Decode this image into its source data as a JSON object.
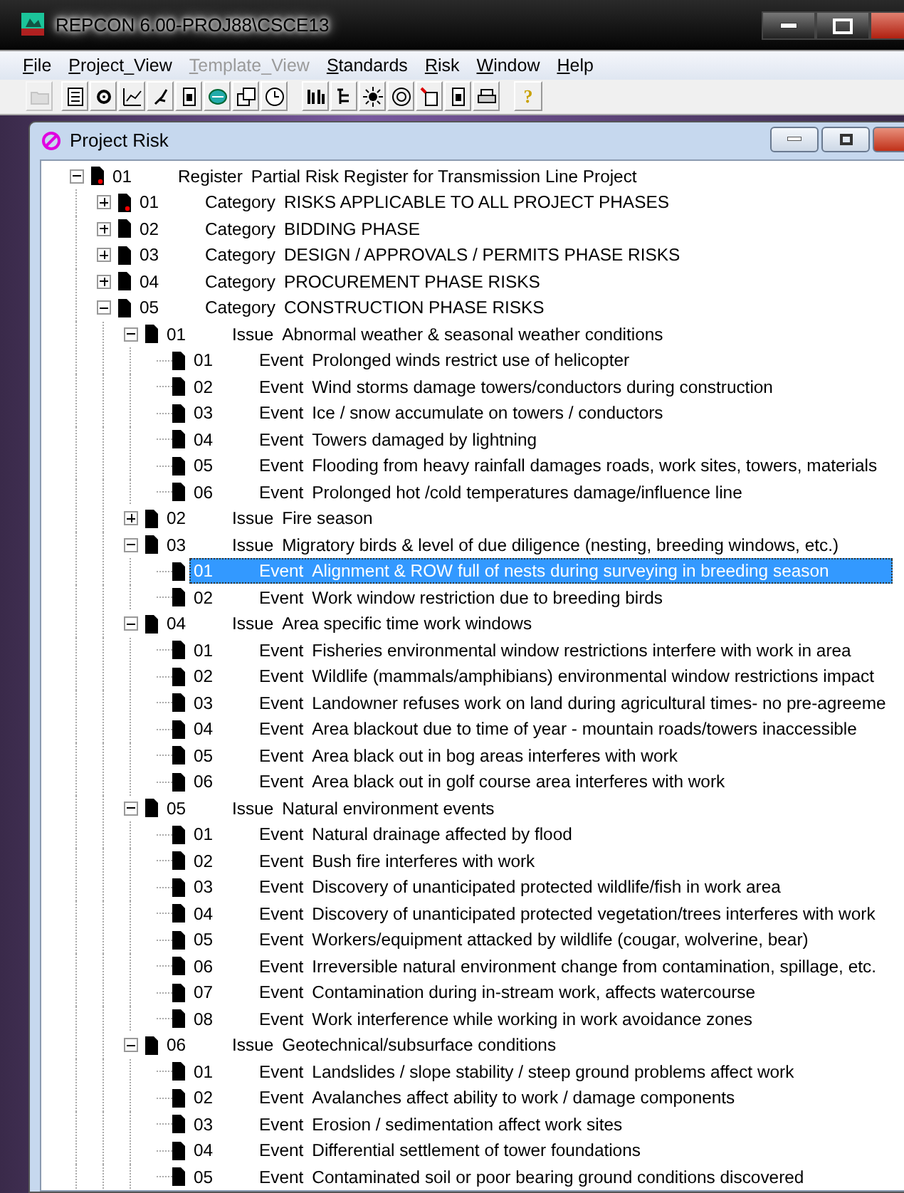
{
  "window": {
    "title": "REPCON 6.00-PROJ88\\CSCE13"
  },
  "menu": [
    {
      "label": "File",
      "disabled": false
    },
    {
      "label": "Project_View",
      "disabled": false
    },
    {
      "label": "Template_View",
      "disabled": true
    },
    {
      "label": "Standards",
      "disabled": false
    },
    {
      "label": "Risk",
      "disabled": false
    },
    {
      "label": "Window",
      "disabled": false
    },
    {
      "label": "Help",
      "disabled": false
    }
  ],
  "toolbar": {
    "help_label": "?"
  },
  "child_window": {
    "title": "Project Risk"
  },
  "tree": [
    {
      "number": "01",
      "type": "Register",
      "title": "Partial Risk Register for Transmission Line Project",
      "expanded": true,
      "selected": false,
      "flagged": true,
      "children": [
        {
          "number": "01",
          "type": "Category",
          "title": "RISKS APPLICABLE TO ALL PROJECT PHASES",
          "expanded": false,
          "selected": false,
          "flagged": true
        },
        {
          "number": "02",
          "type": "Category",
          "title": "BIDDING PHASE",
          "expanded": false,
          "selected": false,
          "flagged": false
        },
        {
          "number": "03",
          "type": "Category",
          "title": "DESIGN / APPROVALS / PERMITS PHASE RISKS",
          "expanded": false,
          "selected": false,
          "flagged": false
        },
        {
          "number": "04",
          "type": "Category",
          "title": "PROCUREMENT PHASE RISKS",
          "expanded": false,
          "selected": false,
          "flagged": false
        },
        {
          "number": "05",
          "type": "Category",
          "title": "CONSTRUCTION PHASE RISKS",
          "expanded": true,
          "selected": false,
          "flagged": false,
          "children": [
            {
              "number": "01",
              "type": "Issue",
              "title": "Abnormal weather & seasonal weather conditions",
              "expanded": true,
              "selected": false,
              "flagged": false,
              "children": [
                {
                  "number": "01",
                  "type": "Event",
                  "title": "Prolonged winds restrict use of helicopter",
                  "selected": false,
                  "flagged": false
                },
                {
                  "number": "02",
                  "type": "Event",
                  "title": "Wind storms damage towers/conductors during construction",
                  "selected": false,
                  "flagged": false
                },
                {
                  "number": "03",
                  "type": "Event",
                  "title": "Ice / snow accumulate on towers / conductors",
                  "selected": false,
                  "flagged": false
                },
                {
                  "number": "04",
                  "type": "Event",
                  "title": "Towers damaged by lightning",
                  "selected": false,
                  "flagged": false
                },
                {
                  "number": "05",
                  "type": "Event",
                  "title": "Flooding from heavy rainfall damages roads, work sites, towers, materials",
                  "selected": false,
                  "flagged": false
                },
                {
                  "number": "06",
                  "type": "Event",
                  "title": "Prolonged hot /cold temperatures damage/influence line",
                  "selected": false,
                  "flagged": false
                }
              ]
            },
            {
              "number": "02",
              "type": "Issue",
              "title": "Fire season",
              "expanded": false,
              "selected": false,
              "flagged": false
            },
            {
              "number": "03",
              "type": "Issue",
              "title": "Migratory birds & level of due diligence (nesting, breeding windows, etc.)",
              "expanded": true,
              "selected": false,
              "flagged": false,
              "children": [
                {
                  "number": "01",
                  "type": "Event",
                  "title": "Alignment & ROW full of nests during surveying in breeding season",
                  "selected": true,
                  "flagged": false
                },
                {
                  "number": "02",
                  "type": "Event",
                  "title": "Work window restriction due to breeding birds",
                  "selected": false,
                  "flagged": false
                }
              ]
            },
            {
              "number": "04",
              "type": "Issue",
              "title": "Area specific time work windows",
              "expanded": true,
              "selected": false,
              "flagged": false,
              "children": [
                {
                  "number": "01",
                  "type": "Event",
                  "title": "Fisheries environmental window restrictions interfere with work in area",
                  "selected": false,
                  "flagged": false
                },
                {
                  "number": "02",
                  "type": "Event",
                  "title": "Wildlife (mammals/amphibians) environmental window restrictions impact",
                  "selected": false,
                  "flagged": false
                },
                {
                  "number": "03",
                  "type": "Event",
                  "title": "Landowner refuses work on land during agricultural times- no pre-agreeme",
                  "selected": false,
                  "flagged": false
                },
                {
                  "number": "04",
                  "type": "Event",
                  "title": "Area blackout due to time of year - mountain roads/towers  inaccessible",
                  "selected": false,
                  "flagged": false
                },
                {
                  "number": "05",
                  "type": "Event",
                  "title": "Area black out in bog areas interferes with work",
                  "selected": false,
                  "flagged": false
                },
                {
                  "number": "06",
                  "type": "Event",
                  "title": "Area black out in golf course area interferes with work",
                  "selected": false,
                  "flagged": false
                }
              ]
            },
            {
              "number": "05",
              "type": "Issue",
              "title": "Natural environment events",
              "expanded": true,
              "selected": false,
              "flagged": false,
              "children": [
                {
                  "number": "01",
                  "type": "Event",
                  "title": "Natural drainage affected by flood",
                  "selected": false,
                  "flagged": false
                },
                {
                  "number": "02",
                  "type": "Event",
                  "title": "Bush fire interferes with work",
                  "selected": false,
                  "flagged": false
                },
                {
                  "number": "03",
                  "type": "Event",
                  "title": "Discovery of unanticipated protected wildlife/fish in work area",
                  "selected": false,
                  "flagged": false
                },
                {
                  "number": "04",
                  "type": "Event",
                  "title": "Discovery of unanticipated protected vegetation/trees interferes with work",
                  "selected": false,
                  "flagged": false
                },
                {
                  "number": "05",
                  "type": "Event",
                  "title": "Workers/equipment attacked by wildlife (cougar, wolverine, bear)",
                  "selected": false,
                  "flagged": false
                },
                {
                  "number": "06",
                  "type": "Event",
                  "title": "Irreversible natural environment change from contamination, spillage, etc.",
                  "selected": false,
                  "flagged": false
                },
                {
                  "number": "07",
                  "type": "Event",
                  "title": "Contamination during in-stream work, affects watercourse",
                  "selected": false,
                  "flagged": false
                },
                {
                  "number": "08",
                  "type": "Event",
                  "title": "Work interference while working in work avoidance zones",
                  "selected": false,
                  "flagged": false
                }
              ]
            },
            {
              "number": "06",
              "type": "Issue",
              "title": "Geotechnical/subsurface conditions",
              "expanded": true,
              "selected": false,
              "flagged": false,
              "children": [
                {
                  "number": "01",
                  "type": "Event",
                  "title": "Landslides / slope stability / steep ground  problems affect work",
                  "selected": false,
                  "flagged": false
                },
                {
                  "number": "02",
                  "type": "Event",
                  "title": "Avalanches affect ability to work / damage components",
                  "selected": false,
                  "flagged": false
                },
                {
                  "number": "03",
                  "type": "Event",
                  "title": "Erosion / sedimentation affect work sites",
                  "selected": false,
                  "flagged": false
                },
                {
                  "number": "04",
                  "type": "Event",
                  "title": "Differential settlement of tower foundations",
                  "selected": false,
                  "flagged": false
                },
                {
                  "number": "05",
                  "type": "Event",
                  "title": "Contaminated soil or poor bearing ground conditions discovered",
                  "selected": false,
                  "flagged": false
                }
              ]
            }
          ]
        }
      ]
    }
  ]
}
